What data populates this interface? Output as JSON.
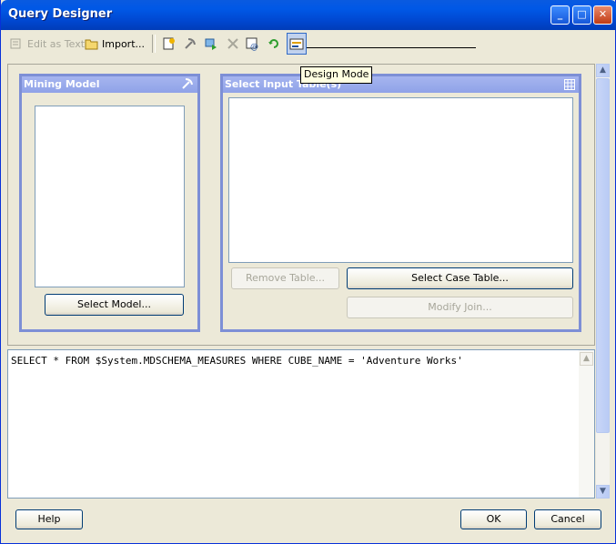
{
  "window": {
    "title": "Query Designer",
    "minimize": "_",
    "maximize": "□",
    "close": "✕"
  },
  "toolbar": {
    "edit_as_text": "Edit as Text",
    "import": "Import...",
    "tooltip": "Design Mode"
  },
  "mining_model": {
    "header": "Mining Model",
    "select_button": "Select Model..."
  },
  "input_table": {
    "header": "Select Input Table(s)",
    "remove_button": "Remove Table...",
    "select_case_button": "Select Case Table...",
    "modify_join_button": "Modify Join..."
  },
  "sql": {
    "text": "SELECT * FROM $System.MDSCHEMA_MEASURES WHERE CUBE_NAME = 'Adventure Works'"
  },
  "footer": {
    "help": "Help",
    "ok": "OK",
    "cancel": "Cancel"
  }
}
